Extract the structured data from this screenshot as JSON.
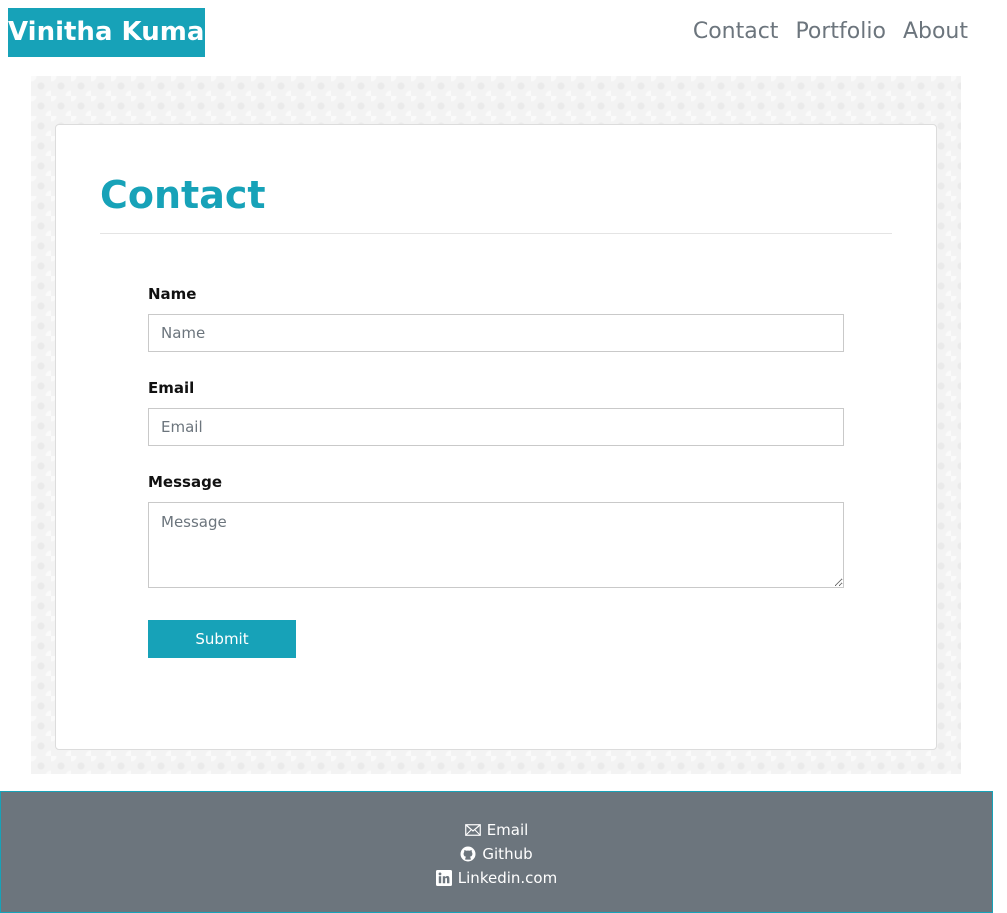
{
  "header": {
    "brand": "Vinitha Kumar",
    "nav": [
      {
        "label": "Contact"
      },
      {
        "label": "Portfolio"
      },
      {
        "label": "About"
      }
    ]
  },
  "contact": {
    "title": "Contact",
    "fields": {
      "name": {
        "label": "Name",
        "placeholder": "Name",
        "value": ""
      },
      "email": {
        "label": "Email",
        "placeholder": "Email",
        "value": ""
      },
      "message": {
        "label": "Message",
        "placeholder": "Message",
        "value": ""
      }
    },
    "submit_label": "Submit"
  },
  "footer": {
    "links": [
      {
        "label": "Email",
        "icon": "envelope-icon"
      },
      {
        "label": "Github",
        "icon": "github-icon"
      },
      {
        "label": "Linkedin.com",
        "icon": "linkedin-icon"
      }
    ]
  },
  "colors": {
    "accent": "#17a2b8",
    "nav_text": "#6c757d",
    "footer_bg": "#6c757d"
  }
}
